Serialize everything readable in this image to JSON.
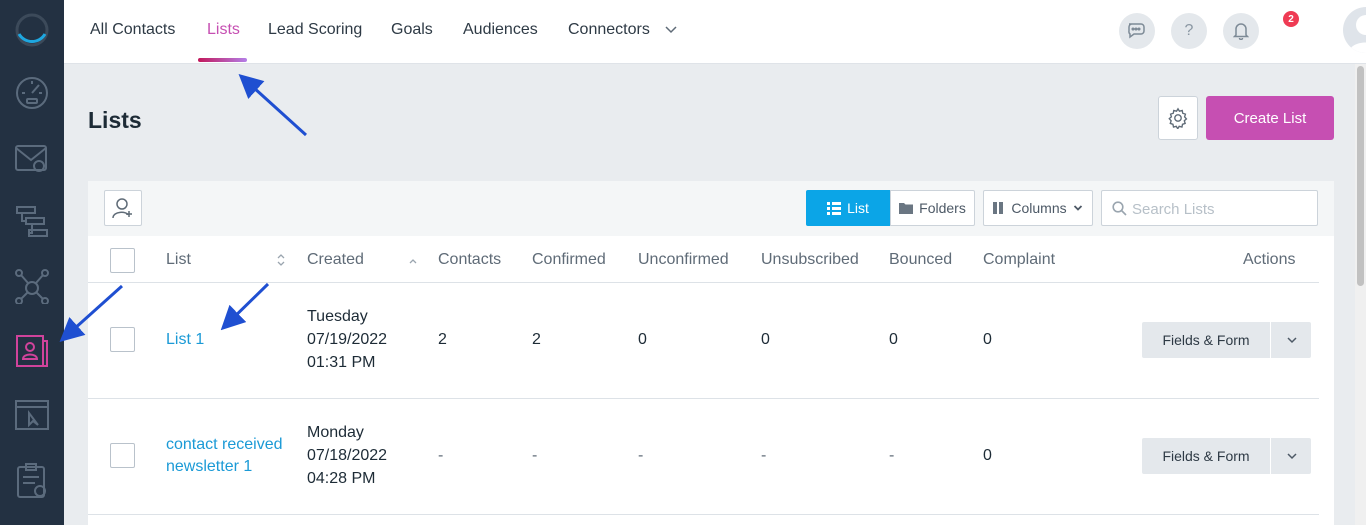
{
  "nav": {
    "tabs": [
      "All Contacts",
      "Lists",
      "Lead Scoring",
      "Goals",
      "Audiences",
      "Connectors"
    ],
    "active_tab": "Lists",
    "notification_count": "2",
    "help_label": "?"
  },
  "sidebar": {
    "icons": [
      "logo-icon",
      "dashboard-icon",
      "email-icon",
      "automation-icon",
      "network-icon",
      "contacts-icon",
      "site-icon",
      "forms-icon"
    ],
    "active_icon": "contacts-icon"
  },
  "page": {
    "title": "Lists",
    "create_button": "Create List"
  },
  "toolbar": {
    "view_list": "List",
    "view_folders": "Folders",
    "columns": "Columns",
    "search_placeholder": "Search Lists"
  },
  "table": {
    "headers": [
      "List",
      "Created",
      "Contacts",
      "Confirmed",
      "Unconfirmed",
      "Unsubscribed",
      "Bounced",
      "Complaint",
      "Actions"
    ],
    "rows": [
      {
        "name_lines": [
          "List 1"
        ],
        "created": [
          "Tuesday",
          "07/19/2022",
          "01:31 PM"
        ],
        "contacts": "2",
        "confirmed": "2",
        "unconfirmed": "0",
        "unsubscribed": "0",
        "bounced": "0",
        "complaint": "0",
        "action": "Fields & Form"
      },
      {
        "name_lines": [
          "contact received",
          "newsletter 1"
        ],
        "created": [
          "Monday",
          "07/18/2022",
          "04:28 PM"
        ],
        "contacts": "-",
        "confirmed": "-",
        "unconfirmed": "-",
        "unsubscribed": "-",
        "bounced": "-",
        "complaint": "0",
        "action": "Fields & Form"
      }
    ]
  },
  "colors": {
    "sidebar_bg": "#233142",
    "accent_pink": "#c64fb2",
    "accent_blue": "#0ba5e7",
    "link_blue": "#1b9ad6",
    "annotation_arrow": "#1f4fd1"
  }
}
